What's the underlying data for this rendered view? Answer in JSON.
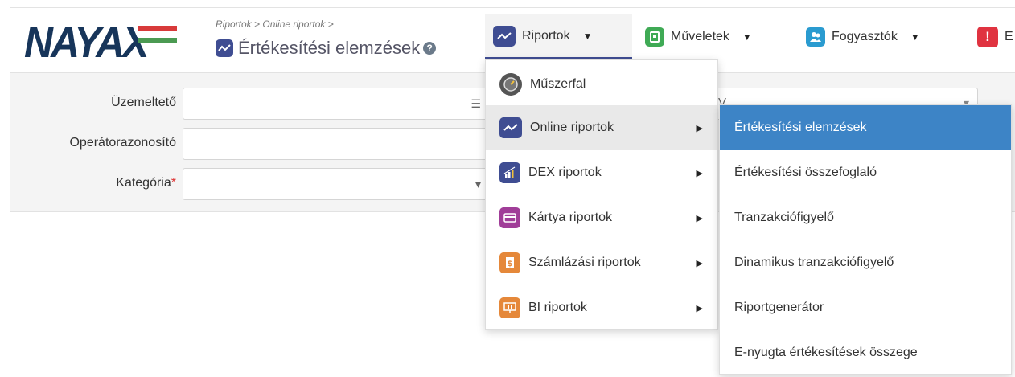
{
  "logo": {
    "text": "NAYAX",
    "flag_colors": [
      "#d83a3a",
      "#ffffff",
      "#4b9a52"
    ]
  },
  "breadcrumb": {
    "part1": "Riportok",
    "sep1": " > ",
    "part2": "Online riportok",
    "sep2": " >"
  },
  "page_title": {
    "text": "Értékesítési elemzések",
    "help_symbol": "?"
  },
  "nav": {
    "items": [
      {
        "label": "Riportok",
        "icon": "chart-line-icon",
        "color": "#3f4d92",
        "active": true
      },
      {
        "label": "Műveletek",
        "icon": "machine-icon",
        "color": "#3faa55"
      },
      {
        "label": "Fogyasztók",
        "icon": "users-icon",
        "color": "#2a9bd0"
      },
      {
        "label": "E",
        "icon": "alert-icon",
        "color": "#e03340"
      }
    ],
    "caret": "▼"
  },
  "filters": {
    "operator_label": "Üzemeltető",
    "operator_id_label": "Operátorazonosító",
    "category_label": "Kategória",
    "required_mark": "*",
    "list_symbol": "☰",
    "dropdown_symbol": "▾",
    "right_partial_text": "V",
    "right_partial_symbol": "▾"
  },
  "menu": {
    "items": [
      {
        "label": "Műszerfal",
        "icon": "dashboard-gauge-icon",
        "color": "#555555",
        "submenu": false
      },
      {
        "label": "Online riportok",
        "icon": "chart-line-icon",
        "color": "#3f4d92",
        "submenu": true,
        "highlighted": true
      },
      {
        "label": "DEX riportok",
        "icon": "dex-bars-icon",
        "color": "#3f4d92",
        "submenu": true
      },
      {
        "label": "Kártya riportok",
        "icon": "card-icon",
        "color": "#a03d98",
        "submenu": true
      },
      {
        "label": "Számlázási riportok",
        "icon": "invoice-icon",
        "color": "#e5883a",
        "submenu": true
      },
      {
        "label": "BI riportok",
        "icon": "bi-presentation-icon",
        "color": "#e5883a",
        "submenu": true
      }
    ],
    "arrow": "▶"
  },
  "submenu": {
    "items": [
      {
        "label": "Értékesítési elemzések",
        "selected": true
      },
      {
        "label": "Értékesítési összefoglaló"
      },
      {
        "label": "Tranzakciófigyelő"
      },
      {
        "label": "Dinamikus tranzakciófigyelő"
      },
      {
        "label": "Riportgenerátor"
      },
      {
        "label": "E-nyugta értékesítések összege"
      }
    ],
    "selected_color": "#3d84c6"
  }
}
